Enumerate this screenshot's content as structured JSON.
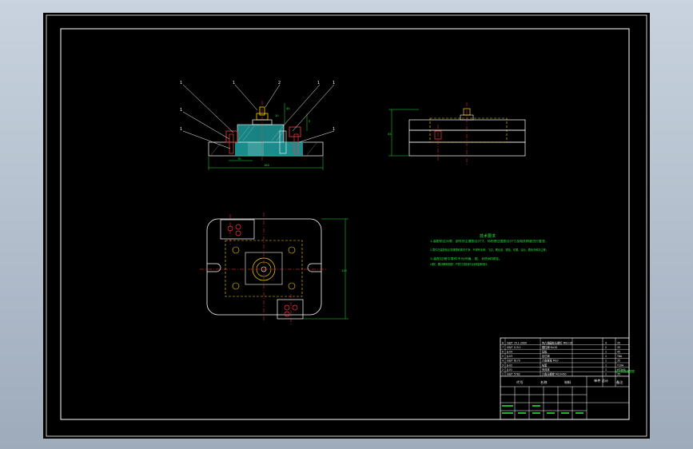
{
  "balloons": [
    "1",
    "1",
    "2",
    "1",
    "1",
    "1",
    "1",
    "1",
    "1"
  ],
  "dimensions": {
    "front_width": "160",
    "front_sub": "70",
    "front_height_a": "40",
    "front_height_b": "5",
    "front_height_c": "10",
    "side_height": "45",
    "plan_height": "120"
  },
  "tech_requirements": {
    "title": "技术要求",
    "lines": [
      "1.装配前应对零、部件的主要配合尺寸，特别是过盈配合尺寸及相关精度进行复查。",
      "2.零件在装配前必须清理和清洗干净，不得有毛刺、飞边、氧化皮、锈蚀、切屑、油污、着色剂和灰尘等。",
      "3.装配过程中零件不允许磕、碰、划伤和锈蚀。",
      "4.螺钉、螺栓和螺母紧固时，严禁打击或使用不合适的旋具和扳手。"
    ]
  },
  "title_block": {
    "parts": [
      {
        "no": "8",
        "code": "GB/T 70.1-2000",
        "name": "内六角圆柱头螺钉 M6×16",
        "qty": "4",
        "material": "35"
      },
      {
        "no": "7",
        "code": "GB/T 119.1",
        "name": "圆柱销 6×20",
        "qty": "2",
        "material": "35"
      },
      {
        "no": "6",
        "code": "JJ-04",
        "name": "压板",
        "qty": "1",
        "material": "45"
      },
      {
        "no": "5",
        "code": "JJ-03",
        "name": "定位销",
        "qty": "1",
        "material": "T8A"
      },
      {
        "no": "4",
        "code": "GB/T 6170",
        "name": "六角螺母 M10",
        "qty": "1",
        "material": "35"
      },
      {
        "no": "3",
        "code": "JJ-02",
        "name": "钻套",
        "qty": "1",
        "material": "T10A"
      },
      {
        "no": "2",
        "code": "JJ-01",
        "name": "夹具体",
        "qty": "1",
        "material": "HT200"
      },
      {
        "no": "1",
        "code": "GB/T 5782",
        "name": "六角头螺栓 M10×60",
        "qty": "1",
        "material": "35"
      }
    ],
    "header": {
      "no": "序号",
      "code": "代号",
      "name": "名称",
      "qty": "数量",
      "material": "材料",
      "mass": "单件 总计",
      "remark": "备注"
    },
    "drawing_name": "钻床夹具装配图"
  }
}
